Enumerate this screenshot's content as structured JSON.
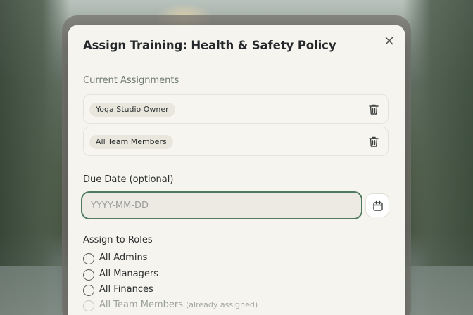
{
  "modal": {
    "title": "Assign Training: Health & Safety Policy",
    "current_assignments_label": "Current Assignments",
    "assignments": [
      {
        "name": "Yoga Studio Owner"
      },
      {
        "name": "All Team Members"
      }
    ],
    "due_date": {
      "label": "Due Date (optional)",
      "value": "",
      "placeholder": "YYYY-MM-DD"
    },
    "assign_roles_label": "Assign to Roles",
    "roles": [
      {
        "label": "All Admins",
        "note": ""
      },
      {
        "label": "All Managers",
        "note": ""
      },
      {
        "label": "All Finances",
        "note": ""
      },
      {
        "label": "All Team Members",
        "note": "(already assigned)"
      }
    ]
  },
  "icons": {
    "close": "close-icon",
    "trash": "trash-icon",
    "calendar": "calendar-icon"
  },
  "colors": {
    "accent": "#4f7a5f",
    "modal_bg": "#f6f4ee",
    "chip_bg": "#e8e6dd"
  }
}
